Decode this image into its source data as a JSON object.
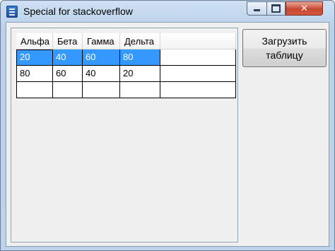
{
  "window": {
    "title": "Special for stackoverflow",
    "icon": "java-app-icon",
    "controls": {
      "minimize": "minimize-icon",
      "maximize": "maximize-icon",
      "close": "✕"
    }
  },
  "table": {
    "columns": [
      "Альфа",
      "Бета",
      "Гамма",
      "Дельта",
      ""
    ],
    "rows": [
      [
        "20",
        "40",
        "60",
        "80",
        ""
      ],
      [
        "80",
        "60",
        "40",
        "20",
        ""
      ],
      [
        "",
        "",
        "",
        "",
        ""
      ]
    ],
    "selected_row": 0,
    "focused_cell": [
      0,
      0
    ],
    "selection_color": "#3399ff"
  },
  "load_button": {
    "line1": "Загрузить",
    "line2": "таблицу"
  }
}
